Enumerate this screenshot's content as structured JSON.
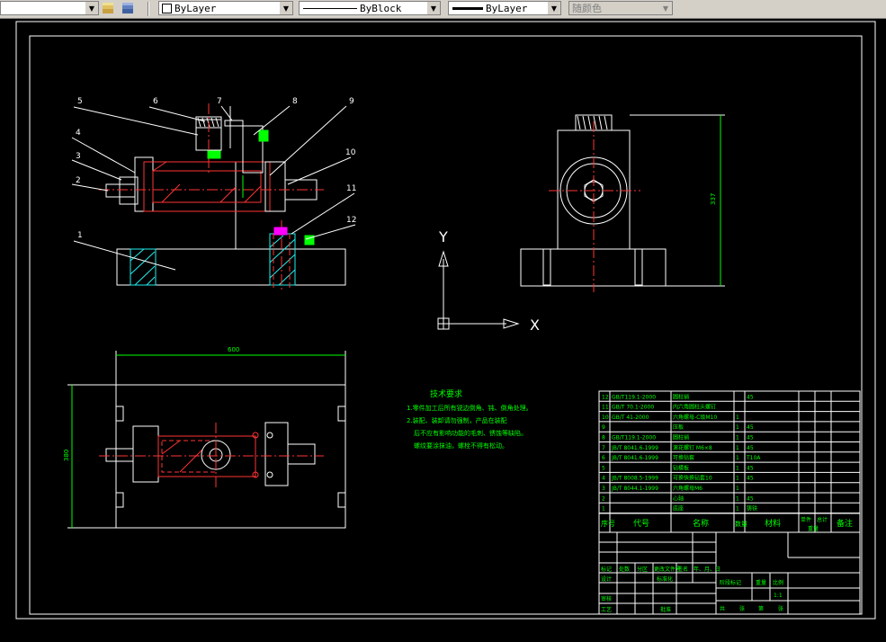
{
  "toolbar": {
    "layer_value": "ByLayer",
    "linetype_value": "ByBlock",
    "lineweight_value": "ByLayer",
    "plotstyle_value": "随颜色"
  },
  "drawing": {
    "part_numbers": [
      "1",
      "2",
      "3",
      "4",
      "5",
      "6",
      "7",
      "8",
      "9",
      "10",
      "11",
      "12"
    ],
    "ucs_x": "X",
    "ucs_y": "Y",
    "dim_width": "600",
    "dim_height": "380",
    "dim_side": "337",
    "tech_req": {
      "title": "技术要求",
      "line1": "1.零件加工后所有锐边倒角、钝、倒角处理。",
      "line2": "2.装配、装卸请勿强制，产品在装配",
      "line3": "后不应有影响功能的毛刺、锈蚀等缺陷。",
      "line4": "螺纹要涂抹油，螺栓不得有松动。"
    }
  },
  "bom": {
    "rows": [
      {
        "no": "12",
        "code": "GB/T119.1-2000",
        "name": "圆柱销",
        "qty": "",
        "mat": "45"
      },
      {
        "no": "11",
        "code": "GB/T 70.1-2000",
        "name": "内六角圆柱头螺钉",
        "qty": "",
        "mat": ""
      },
      {
        "no": "10",
        "code": "GB/T 41-2000",
        "name": "六角螺母-C级M10",
        "qty": "1",
        "mat": ""
      },
      {
        "no": "9",
        "code": "",
        "name": "压板",
        "qty": "1",
        "mat": "45"
      },
      {
        "no": "8",
        "code": "GB/T119.1-2000",
        "name": "圆柱销",
        "qty": "1",
        "mat": "45"
      },
      {
        "no": "7",
        "code": "JB/T 8041.6-1999",
        "name": "滚花螺钉 M6×8",
        "qty": "1",
        "mat": "45"
      },
      {
        "no": "6",
        "code": "JB/T 8041.6-1999",
        "name": "可换钻套",
        "qty": "1",
        "mat": "T10A"
      },
      {
        "no": "5",
        "code": "",
        "name": "钻模板",
        "qty": "1",
        "mat": "45"
      },
      {
        "no": "4",
        "code": "JB/T 8008.5-1999",
        "name": "可换快换钻套10",
        "qty": "1",
        "mat": "45"
      },
      {
        "no": "3",
        "code": "JB/T 8044.1-1999",
        "name": "六角螺母M6",
        "qty": "1",
        "mat": ""
      },
      {
        "no": "2",
        "code": "",
        "name": "心轴",
        "qty": "1",
        "mat": "45"
      },
      {
        "no": "1",
        "code": "",
        "name": "底座",
        "qty": "1",
        "mat": "铸铁"
      }
    ],
    "header": {
      "no": "序号",
      "code": "代号",
      "name": "名称",
      "qty": "数量",
      "mat": "材料",
      "unit": "单件",
      "total": "总计",
      "weight": "重量",
      "remark": "备注"
    },
    "title_block": {
      "r1": [
        "标记",
        "处数",
        "分区",
        "更改文件号",
        "签名",
        "年、月、日"
      ],
      "r2": [
        "设计",
        "标准化"
      ],
      "r3": [
        "阶段标记",
        "重量",
        "比例"
      ],
      "scale": "1:1",
      "r4": [
        "审核"
      ],
      "r5": [
        "工艺",
        "批准"
      ],
      "r6": [
        "共",
        "张",
        "第",
        "张"
      ]
    }
  }
}
